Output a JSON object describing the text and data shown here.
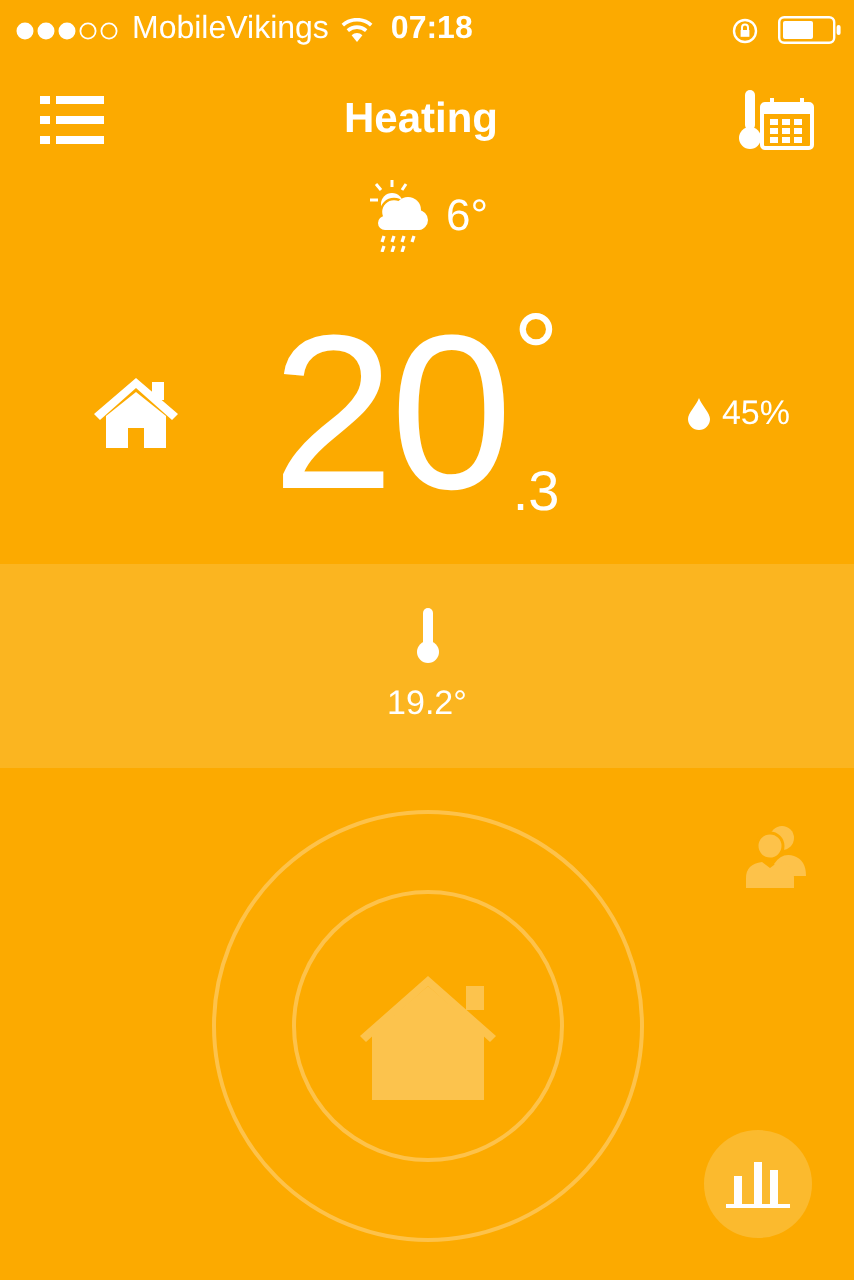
{
  "status_bar": {
    "carrier": "MobileVikings",
    "time": "07:18"
  },
  "header": {
    "title": "Heating"
  },
  "weather": {
    "temperature": "6°"
  },
  "current": {
    "whole": "20",
    "degree": "°",
    "decimal": ".3"
  },
  "humidity": {
    "reading": "45%"
  },
  "indoor": {
    "reading": "19.2°"
  }
}
